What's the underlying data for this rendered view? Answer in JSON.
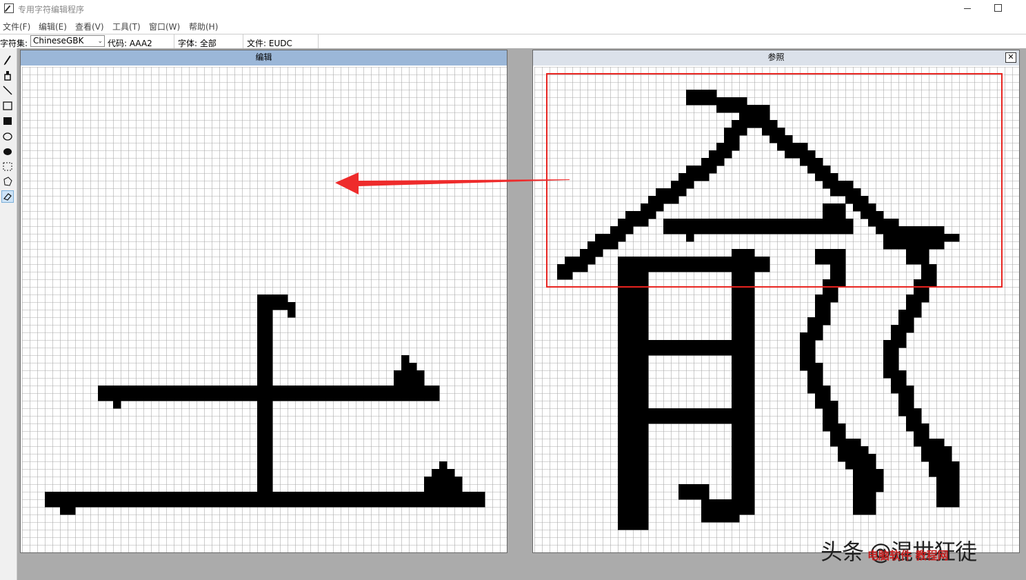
{
  "window": {
    "title": "专用字符编辑程序"
  },
  "menu": [
    "文件(F)",
    "编辑(E)",
    "查看(V)",
    "工具(T)",
    "窗口(W)",
    "帮助(H)"
  ],
  "toolbar": {
    "charset_label": "字符集:",
    "charset_value": "ChineseGBK",
    "code": "代码: AAA2",
    "font": "字体: 全部",
    "file": "文件: EUDC"
  },
  "tools": [
    "pencil-icon",
    "brush-icon",
    "line-icon",
    "rect-outline-icon",
    "rect-filled-icon",
    "ellipse-outline-icon",
    "ellipse-filled-icon",
    "rect-select-icon",
    "freeform-select-icon",
    "eraser-icon"
  ],
  "edit_panel": {
    "title": "编辑"
  },
  "ref_panel": {
    "title": "参照",
    "close": "✕"
  },
  "watermark": {
    "text": "头条 @混世狂徒",
    "sub": "电脑软件 教程网"
  },
  "colors": {
    "grid": "#a9a9a9",
    "pixel": "#000000",
    "highlight": "#e8231f",
    "arrow": "#ee2b2b"
  }
}
